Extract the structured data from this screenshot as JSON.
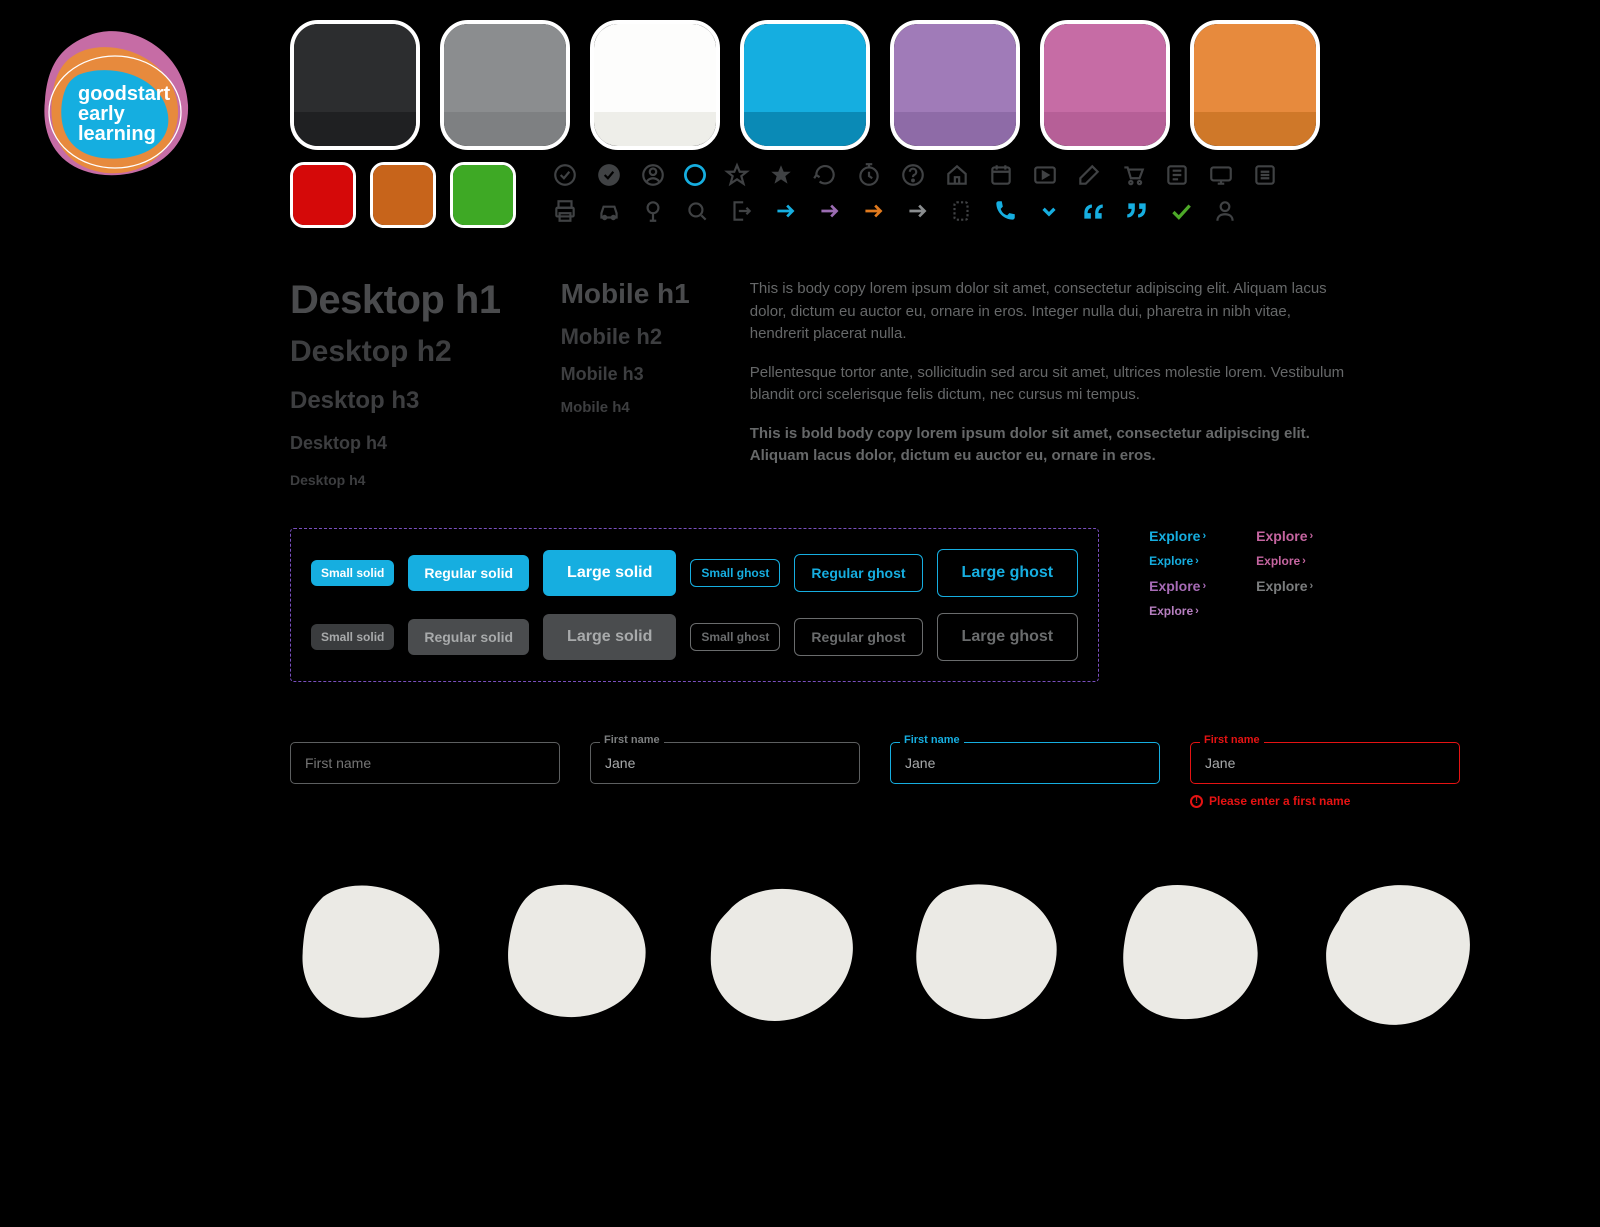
{
  "brand": {
    "line1": "goodstart",
    "line2": "early",
    "line3": "learning"
  },
  "palette_primary": [
    {
      "name": "charcoal",
      "top": "#2c2d2f",
      "bot": "#1f2022"
    },
    {
      "name": "grey",
      "top": "#8b8d8f",
      "bot": "#7e8082"
    },
    {
      "name": "offwhite",
      "top": "#fdfdfc",
      "bot": "#eeeee9"
    },
    {
      "name": "cyan",
      "top": "#15aee0",
      "bot": "#0a8ab6"
    },
    {
      "name": "purple",
      "top": "#a07bb8",
      "bot": "#8e6ba7"
    },
    {
      "name": "pink",
      "top": "#c66ca5",
      "bot": "#b65f97"
    },
    {
      "name": "orange",
      "top": "#e78a3d",
      "bot": "#cf7829"
    }
  ],
  "palette_status": [
    {
      "name": "red",
      "color": "#d50909"
    },
    {
      "name": "brown",
      "color": "#c7641b"
    },
    {
      "name": "green",
      "color": "#3ea925"
    }
  ],
  "icons_row1": [
    "check-circle-outline",
    "check-circle-solid",
    "user-outline",
    "user-solid",
    "star-outline",
    "star-solid",
    "refresh",
    "clock",
    "question-circle",
    "home",
    "calendar",
    "video",
    "edit",
    "cart",
    "news",
    "screen",
    "list"
  ],
  "icons_row2": [
    "print",
    "car",
    "tree",
    "search",
    "logout",
    "arrow-cyan",
    "arrow-purple",
    "arrow-orange",
    "arrow-grey",
    "marker",
    "phone-cyan",
    "chevron-cyan",
    "quote-open-cyan",
    "quote-close-cyan",
    "tick-green",
    "person-outline"
  ],
  "typography": {
    "desktop": {
      "h1": "Desktop h1",
      "h2": "Desktop h2",
      "h3": "Desktop h3",
      "h4": "Desktop h4",
      "h5": "Desktop h4"
    },
    "mobile": {
      "h1": "Mobile h1",
      "h2": "Mobile h2",
      "h3": "Mobile h3",
      "h4": "Mobile h4"
    },
    "body1": "This is body copy lorem ipsum dolor sit amet, consectetur adipiscing elit. Aliquam lacus dolor, dictum eu auctor eu, ornare in eros. Integer nulla dui, pharetra in nibh vitae, hendrerit placerat nulla.",
    "body2": "Pellentesque tortor ante, sollicitudin sed arcu sit amet, ultrices molestie lorem. Vestibulum blandit orci scelerisque felis dictum, nec cursus mi tempus.",
    "body_bold": "This is bold body copy lorem ipsum dolor sit amet, consectetur adipiscing elit. Aliquam lacus dolor, dictum eu auctor eu, ornare in eros."
  },
  "buttons": {
    "small_solid": "Small solid",
    "regular_solid": "Regular solid",
    "large_solid": "Large solid",
    "small_ghost": "Small ghost",
    "regular_ghost": "Regular ghost",
    "large_ghost": "Large ghost"
  },
  "explore_label": "Explore",
  "inputs": {
    "label": "First name",
    "value": "Jane",
    "placeholder": "First name",
    "error": "Please enter a first name"
  }
}
